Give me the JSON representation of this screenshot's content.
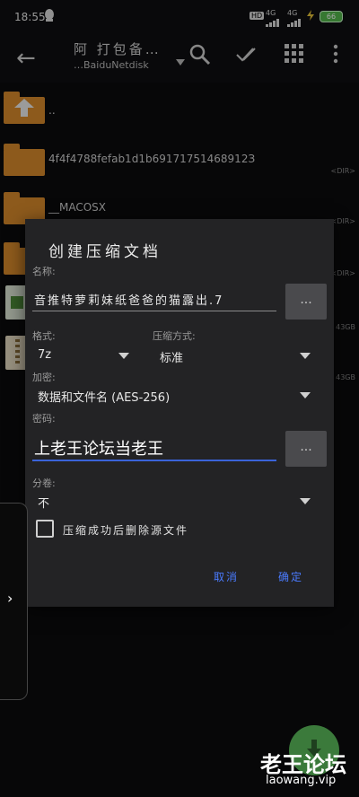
{
  "status_bar": {
    "time": "18:55",
    "hd": "HD",
    "net1": "4G",
    "net2": "4G",
    "battery": "66"
  },
  "toolbar": {
    "title": "阿 打包备…",
    "subtitle": "…BaiduNetdisk"
  },
  "files": [
    {
      "name": "..",
      "tag": ""
    },
    {
      "name": "4f4f4788fefab1d1b69171751468912З",
      "tag": "<DIR>"
    },
    {
      "name": "__MACOSX",
      "tag": "<DIR>"
    },
    {
      "name": "",
      "tag": "<DIR>"
    },
    {
      "name": "",
      "tag": "43GB"
    },
    {
      "name": "",
      "tag": "43GB"
    }
  ],
  "dialog": {
    "title": "创建压缩文档",
    "name_label": "名称:",
    "name_value": "音推特萝莉妹纸爸爸的猫露出.7",
    "browse1": "...",
    "format_label": "格式:",
    "format_value": "7z",
    "method_label": "压缩方式:",
    "method_value": "标准",
    "encrypt_label": "加密:",
    "encrypt_value": "数据和文件名 (AES-256)",
    "password_label": "密码:",
    "password_value": "上老王论坛当老王",
    "browse2": "...",
    "split_label": "分卷:",
    "split_value": "不",
    "delete_label": "压缩成功后删除源文件",
    "cancel": "取消",
    "ok": "确定"
  },
  "watermark": {
    "line1": "老王论坛",
    "line2": "laowang.vip"
  },
  "colors": {
    "accent": "#4a7bff",
    "password_underline": "#3a63d9",
    "folder": "#d98a2b",
    "dialog_bg": "#232325"
  }
}
